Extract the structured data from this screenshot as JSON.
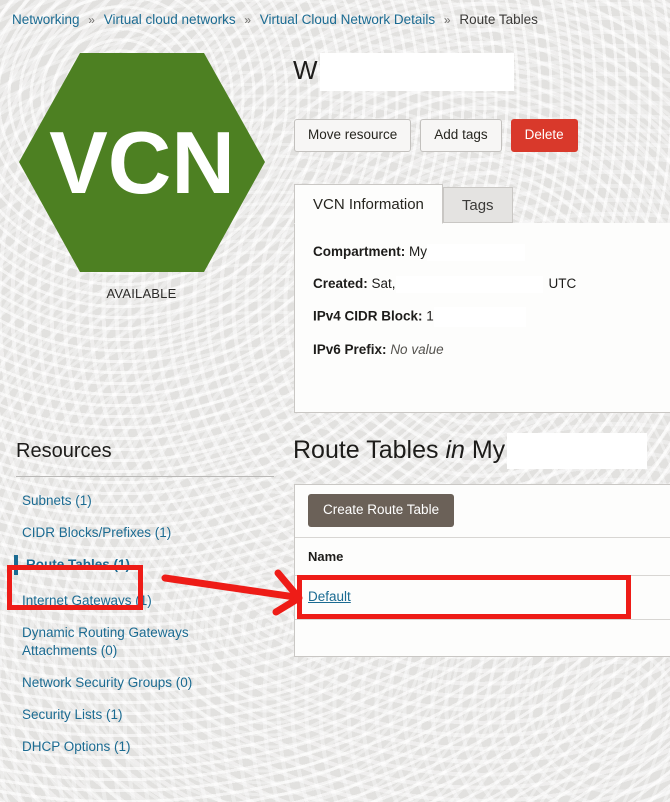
{
  "breadcrumb": {
    "items": [
      {
        "label": "Networking",
        "link": true
      },
      {
        "label": "Virtual cloud networks",
        "link": true
      },
      {
        "label": "Virtual Cloud Network Details",
        "link": true
      },
      {
        "label": "Route Tables",
        "link": false
      }
    ],
    "separator": "»"
  },
  "resource_badge": {
    "shape": "hexagon",
    "abbreviation": "VCN",
    "color": "#4d8022",
    "status": "AVAILABLE"
  },
  "detail": {
    "title_prefix": "W",
    "title_redacted": true
  },
  "actions": {
    "move_resource": "Move resource",
    "add_tags": "Add tags",
    "delete": "Delete",
    "delete_color": "#d9392b"
  },
  "info_panel": {
    "tabs": [
      {
        "label": "VCN Information",
        "active": true
      },
      {
        "label": "Tags",
        "active": false
      }
    ],
    "rows": [
      {
        "label": "Compartment:",
        "value": "My",
        "redacted": true,
        "suffix": ""
      },
      {
        "label": "Created:",
        "value": "Sat,",
        "redacted": true,
        "suffix": "UTC"
      },
      {
        "label": "IPv4 CIDR Block:",
        "value": "1",
        "redacted": true,
        "suffix": ""
      },
      {
        "label": "IPv6 Prefix:",
        "value": "No value",
        "redacted": false,
        "suffix": "",
        "italic": true
      }
    ]
  },
  "resources": {
    "heading": "Resources",
    "items": [
      {
        "label": "Subnets (1)",
        "active": false
      },
      {
        "label": "CIDR Blocks/Prefixes (1)",
        "active": false
      },
      {
        "label": "Route Tables (1)",
        "active": true
      },
      {
        "label": "Internet Gateways (1)",
        "active": false
      },
      {
        "label": "Dynamic Routing Gateways Attachments (0)",
        "active": false
      },
      {
        "label": "Network Security Groups (0)",
        "active": false
      },
      {
        "label": "Security Lists (1)",
        "active": false
      },
      {
        "label": "DHCP Options (1)",
        "active": false
      }
    ]
  },
  "route_tables": {
    "heading_main": "Route Tables",
    "heading_in": "in",
    "heading_compartment": "My",
    "create_button": "Create Route Table",
    "create_button_color": "#6b6158",
    "columns": [
      "Name"
    ],
    "rows": [
      {
        "name": "Default"
      }
    ]
  },
  "annotations": {
    "color": "#ee1c17",
    "highlight_sidebar_item": "Route Tables (1)",
    "highlight_table_row": "Default",
    "arrow": "points from sidebar Route Tables to Default row"
  }
}
